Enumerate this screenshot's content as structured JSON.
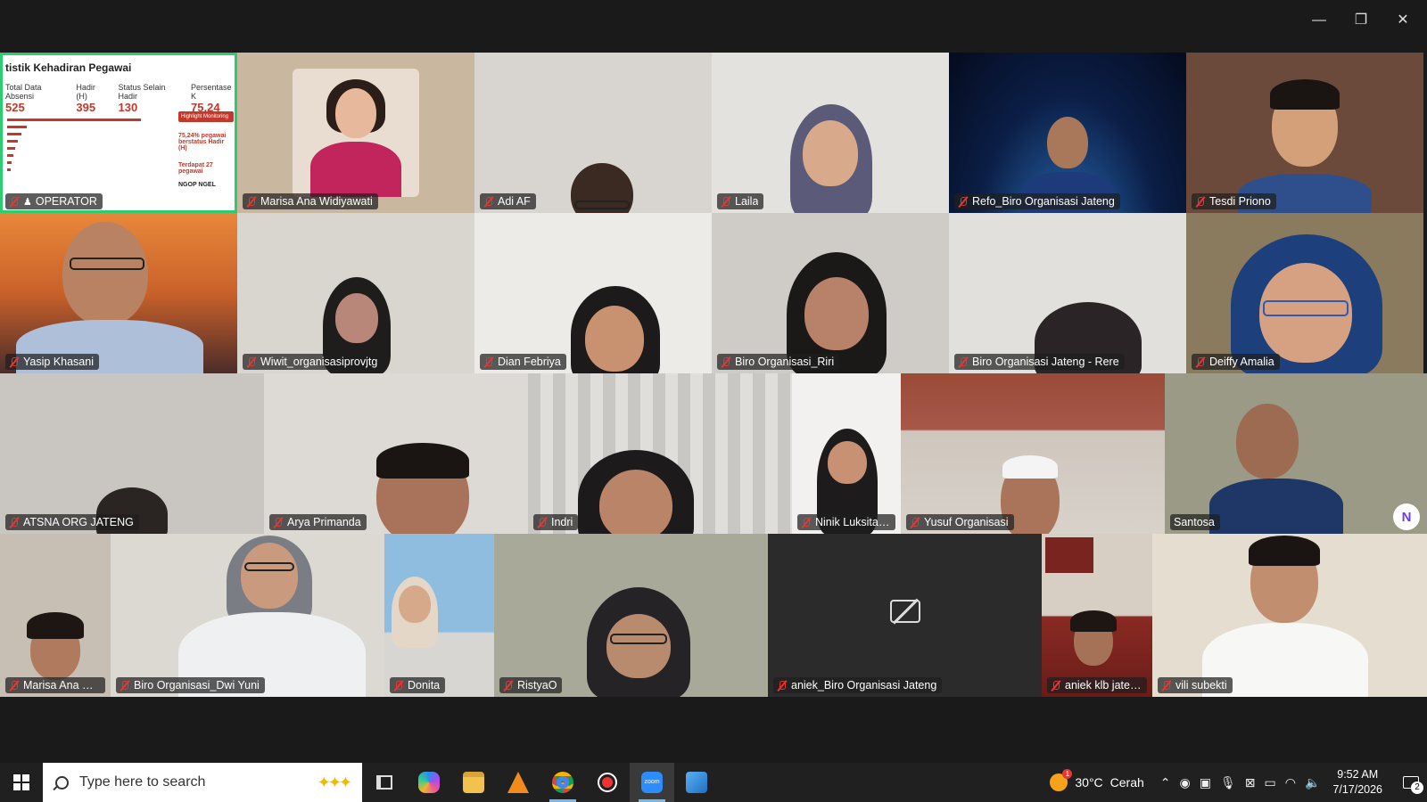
{
  "window": {
    "minimize_glyph": "—",
    "maximize_glyph": "❐",
    "close_glyph": "✕"
  },
  "slide": {
    "title": "tistik Kehadiran Pegawai",
    "stats": [
      {
        "label": "Total Data Absensi",
        "value": "525"
      },
      {
        "label": "Hadir (H)",
        "value": "395"
      },
      {
        "label": "Status Selain Hadir",
        "value": "130"
      },
      {
        "label": "Persentase K",
        "value": "75,24"
      }
    ],
    "badge": "Highlight Monitoring",
    "note1": "75,24% pegawai berstatus Hadir (H)",
    "note2": "Terdapat 27 pegawai",
    "footer": "NGOP NGEL"
  },
  "participants": {
    "r0": [
      "OPERATOR",
      "Marisa Ana Widiyawati",
      "Adi AF",
      "Laila",
      "Refo_Biro Organisasi Jateng",
      "Tesdi Priono"
    ],
    "r1": [
      "Yasip Khasani",
      "Wiwit_organisasiprovjtg",
      "Dian Febriya",
      "Biro Organisasi_Riri",
      "Biro Organisasi Jateng - Rere",
      "Deiffy Amalia"
    ],
    "r2": [
      "ATSNA ORG JATENG",
      "Arya Primanda",
      "Indri",
      "Ninik Luksitaw...",
      "Yusuf Organisasi",
      "Santosa"
    ],
    "r3": [
      "Marisa Ana Wi...",
      "Biro Organisasi_Dwi Yuni",
      "Donita",
      "RistyaO",
      "aniek_Biro Organisasi Jateng",
      "aniek klb jateng",
      "vili subekti"
    ]
  },
  "colors": {
    "active_speaker": "#2ecc71",
    "muted_mic": "#e33333"
  },
  "taskbar": {
    "search_placeholder": "Type here to search",
    "weather_temp": "30°C",
    "weather_desc": "Cerah",
    "weather_alert": "1",
    "time": "9:52 AM",
    "date": "7/17/2026",
    "notifications": "2",
    "apps": [
      "task-view-icon",
      "copilot-icon",
      "file-explorer-icon",
      "vlc-icon",
      "chrome-icon",
      "record-icon",
      "zoom-icon",
      "photos-icon"
    ]
  }
}
